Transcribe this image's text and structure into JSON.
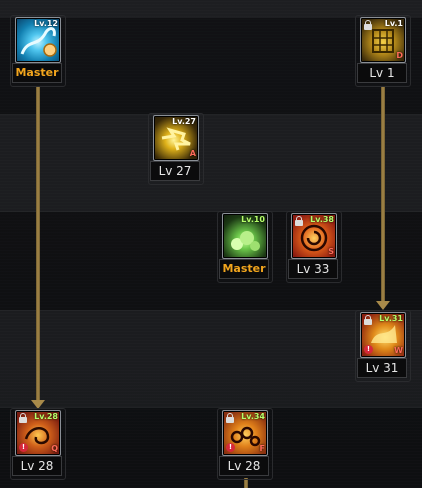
{
  "skills": [
    {
      "id": "tl",
      "level_tag": "Lv.12",
      "label": "Master",
      "label_style": "master",
      "grade": "",
      "locked": false,
      "warn": false,
      "tag_green": false,
      "icon_bg": "#1d9ac6",
      "icon_fg": "#bdefff"
    },
    {
      "id": "tr",
      "level_tag": "Lv.1",
      "label": "Lv 1",
      "label_style": "normal",
      "grade": "D",
      "locked": true,
      "warn": false,
      "tag_green": false,
      "icon_bg": "#3a2d12",
      "icon_fg": "#f0c03a"
    },
    {
      "id": "m27",
      "level_tag": "Lv.27",
      "label": "Lv 27",
      "label_style": "normal",
      "grade": "A",
      "locked": false,
      "warn": false,
      "tag_green": false,
      "icon_bg": "#2a2210",
      "icon_fg": "#ffdd33"
    },
    {
      "id": "m10",
      "level_tag": "Lv.10",
      "label": "Master",
      "label_style": "master",
      "grade": "",
      "locked": false,
      "warn": false,
      "tag_green": true,
      "icon_bg": "#1e2a14",
      "icon_fg": "#9ef07a"
    },
    {
      "id": "m33",
      "level_tag": "Lv.38",
      "label": "Lv 33",
      "label_style": "normal",
      "grade": "S",
      "locked": true,
      "warn": false,
      "tag_green": true,
      "icon_bg": "#8a1a10",
      "icon_fg": "#ffb020"
    },
    {
      "id": "r31",
      "level_tag": "Lv.31",
      "label": "Lv 31",
      "label_style": "normal",
      "grade": "W",
      "locked": true,
      "warn": true,
      "tag_green": true,
      "icon_bg": "#8a2010",
      "icon_fg": "#ffb030"
    },
    {
      "id": "bl",
      "level_tag": "Lv.28",
      "label": "Lv 28",
      "label_style": "normal",
      "grade": "Q",
      "locked": true,
      "warn": true,
      "tag_green": true,
      "icon_bg": "#7a1c10",
      "icon_fg": "#ffa020"
    },
    {
      "id": "bm",
      "level_tag": "Lv.34",
      "label": "Lv 28",
      "label_style": "normal",
      "grade": "F",
      "locked": true,
      "warn": true,
      "tag_green": true,
      "icon_bg": "#8a3010",
      "icon_fg": "#ffb020"
    }
  ]
}
